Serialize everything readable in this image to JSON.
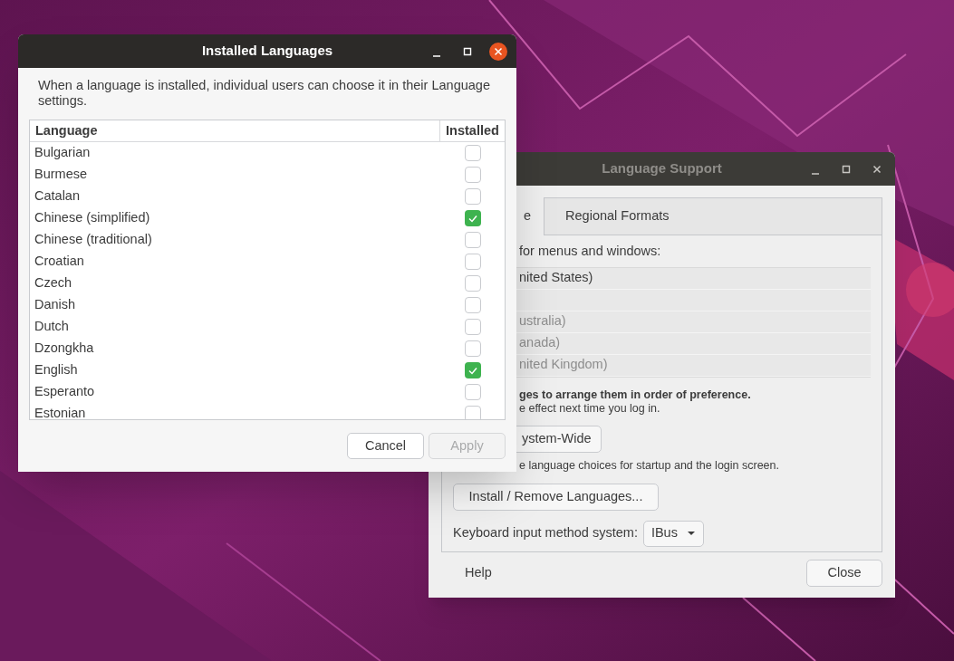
{
  "installed_languages_window": {
    "title": "Installed Languages",
    "focused": true,
    "description": "When a language is installed, individual users can choose it in their Language settings.",
    "columns": [
      "Language",
      "Installed"
    ],
    "rows": [
      {
        "language": "Bulgarian",
        "installed": false
      },
      {
        "language": "Burmese",
        "installed": false
      },
      {
        "language": "Catalan",
        "installed": false
      },
      {
        "language": "Chinese (simplified)",
        "installed": true
      },
      {
        "language": "Chinese (traditional)",
        "installed": false
      },
      {
        "language": "Croatian",
        "installed": false
      },
      {
        "language": "Czech",
        "installed": false
      },
      {
        "language": "Danish",
        "installed": false
      },
      {
        "language": "Dutch",
        "installed": false
      },
      {
        "language": "Dzongkha",
        "installed": false
      },
      {
        "language": "English",
        "installed": true
      },
      {
        "language": "Esperanto",
        "installed": false
      },
      {
        "language": "Estonian",
        "installed": false
      }
    ],
    "buttons": [
      {
        "label": "Cancel",
        "disabled": false
      },
      {
        "label": "Apply",
        "disabled": true
      }
    ]
  },
  "language_support_window": {
    "title": "Language Support",
    "focused": false,
    "tabs": [
      {
        "label": "e",
        "selected": true
      },
      {
        "label": "Regional Formats",
        "selected": false
      }
    ],
    "list_label": "for menus and windows:",
    "languages": [
      {
        "kind": "text",
        "label": "nited States)",
        "muted": false
      },
      {
        "kind": "blank"
      },
      {
        "kind": "text",
        "label": "ustralia)",
        "muted": true
      },
      {
        "kind": "text",
        "label": "anada)",
        "muted": true
      },
      {
        "kind": "text",
        "label": "nited Kingdom)",
        "muted": true
      }
    ],
    "hint_bold": "ges to arrange them in order of preference.",
    "hint": "e effect next time you log in.",
    "apply_button": "ystem-Wide",
    "apply_hint": "e language choices for startup and the login screen.",
    "install_button": "Install / Remove Languages...",
    "keyboard_label": "Keyboard input method system:",
    "keyboard_value": "IBus",
    "help": "Help",
    "close": "Close"
  }
}
